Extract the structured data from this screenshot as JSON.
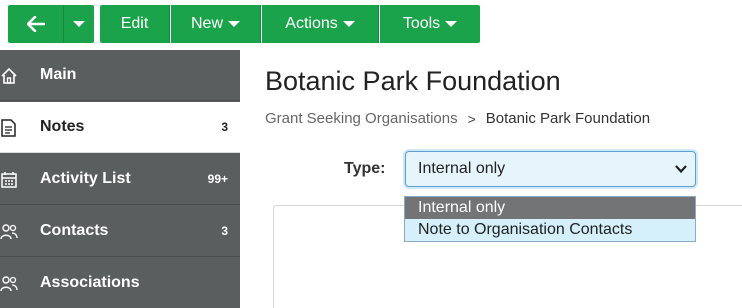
{
  "toolbar": {
    "edit_label": "Edit",
    "new_label": "New",
    "actions_label": "Actions",
    "tools_label": "Tools",
    "accent": "#1aa34a"
  },
  "sidebar": {
    "items": [
      {
        "label": "Main",
        "count": "",
        "icon": "home-icon"
      },
      {
        "label": "Notes",
        "count": "3",
        "icon": "note-icon"
      },
      {
        "label": "Activity List",
        "count": "99+",
        "icon": "calendar-icon"
      },
      {
        "label": "Contacts",
        "count": "3",
        "icon": "people-icon"
      },
      {
        "label": "Associations",
        "count": "",
        "icon": "people-icon"
      }
    ]
  },
  "page": {
    "title": "Botanic Park Foundation",
    "breadcrumb": {
      "parent": "Grant Seeking Organisations",
      "separator": ">",
      "current": "Botanic Park Foundation"
    }
  },
  "form": {
    "type_label": "Type:",
    "type_value": "Internal only",
    "type_options": [
      "Internal only",
      "Note to Organisation Contacts"
    ]
  }
}
